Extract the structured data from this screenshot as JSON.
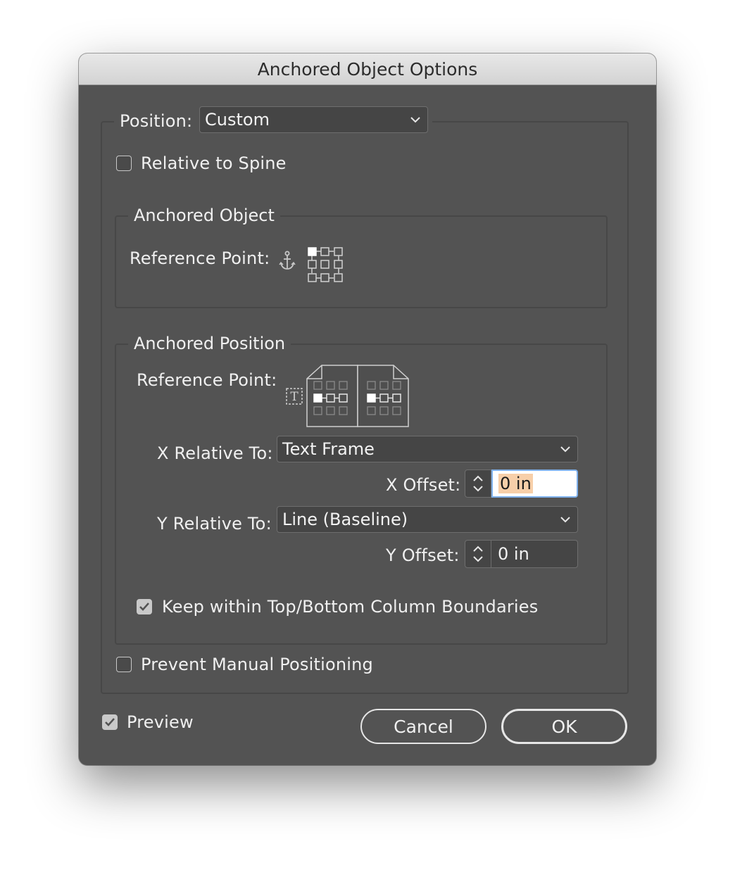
{
  "dialog": {
    "title": "Anchored Object Options"
  },
  "position": {
    "label": "Position:",
    "value": "Custom"
  },
  "relative_to_spine": {
    "label": "Relative to Spine",
    "checked": false
  },
  "anchored_object": {
    "legend": "Anchored Object",
    "reference_point_label": "Reference Point:",
    "anchor_icon": "anchor-icon",
    "selected_point": "top-left"
  },
  "anchored_position": {
    "legend": "Anchored Position",
    "reference_point_label": "Reference Point:",
    "text_frame_icon": "text-frame-icon",
    "selected_point": "middle-left",
    "x_relative_label": "X Relative To:",
    "x_relative_value": "Text Frame",
    "x_offset_label": "X Offset:",
    "x_offset_value": "0 in",
    "y_relative_label": "Y Relative To:",
    "y_relative_value": "Line (Baseline)",
    "y_offset_label": "Y Offset:",
    "y_offset_value": "0 in",
    "keep_within_label": "Keep within Top/Bottom Column Boundaries",
    "keep_within_checked": true
  },
  "prevent_manual": {
    "label": "Prevent Manual Positioning",
    "checked": false
  },
  "footer": {
    "preview_label": "Preview",
    "preview_checked": true,
    "cancel_label": "Cancel",
    "ok_label": "OK"
  },
  "colors": {
    "dialog_bg": "#535353",
    "field_bg": "#454545",
    "focus_ring": "#7fb1ec",
    "selection_highlight": "#f7cfa9"
  }
}
